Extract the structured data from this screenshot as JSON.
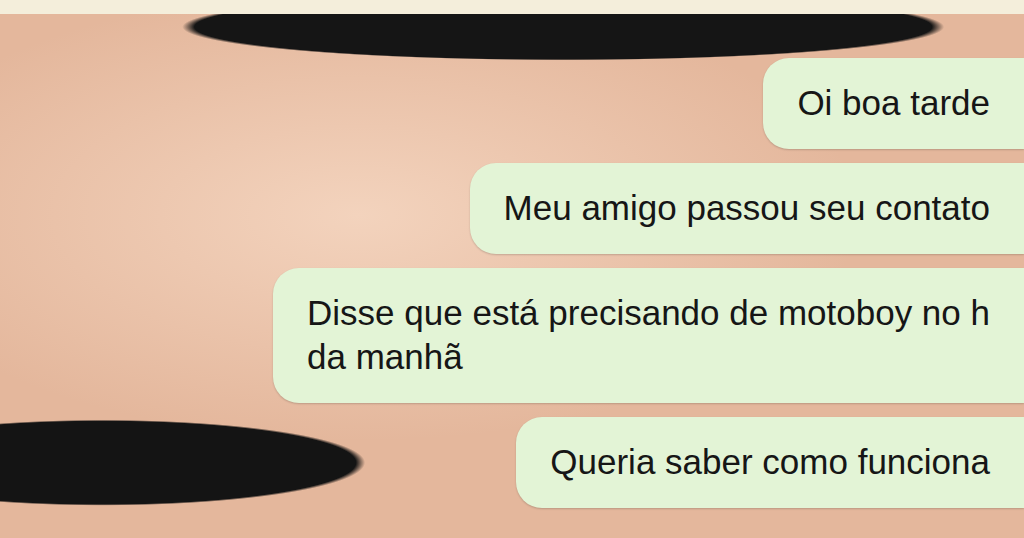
{
  "messages": [
    {
      "lines": [
        "Oi boa tarde"
      ],
      "sent": true
    },
    {
      "lines": [
        "Meu amigo passou seu contato"
      ],
      "sent": true
    },
    {
      "lines": [
        "Disse que está precisando de motoboy no h",
        "da manhã"
      ],
      "sent": true
    },
    {
      "lines": [
        "Queria saber como funciona"
      ],
      "sent": true
    }
  ]
}
